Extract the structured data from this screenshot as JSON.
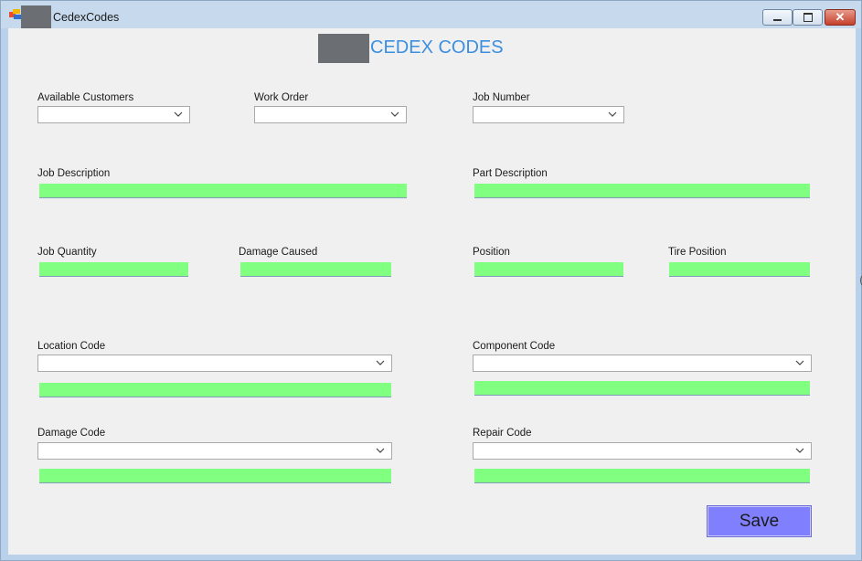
{
  "window": {
    "title": "CedexCodes"
  },
  "header": {
    "title": "CEDEX CODES"
  },
  "labels": {
    "available_customers": "Available Customers",
    "work_order": "Work Order",
    "job_number": "Job Number",
    "job_description": "Job Description",
    "part_description": "Part Description",
    "job_quantity": "Job Quantity",
    "damage_caused": "Damage Caused",
    "position": "Position",
    "tire_position": "Tire Position",
    "location_code": "Location Code",
    "component_code": "Component Code",
    "damage_code": "Damage Code",
    "repair_code": "Repair Code"
  },
  "fields": {
    "available_customers": "",
    "work_order": "",
    "job_number": "",
    "job_description": "",
    "part_description": "",
    "job_quantity": "",
    "damage_caused": "",
    "position": "",
    "tire_position": "",
    "location_code": "",
    "location_code_text": "",
    "component_code": "",
    "component_code_text": "",
    "damage_code": "",
    "damage_code_text": "",
    "repair_code": "",
    "repair_code_text": ""
  },
  "buttons": {
    "save": "Save"
  },
  "colors": {
    "field_bg": "#80ff80",
    "save_bg": "#8080ff",
    "title_color": "#3c8fe0"
  },
  "icons": [
    "app-icon",
    "minimize-icon",
    "maximize-icon",
    "close-icon",
    "chevron-down-icon"
  ]
}
